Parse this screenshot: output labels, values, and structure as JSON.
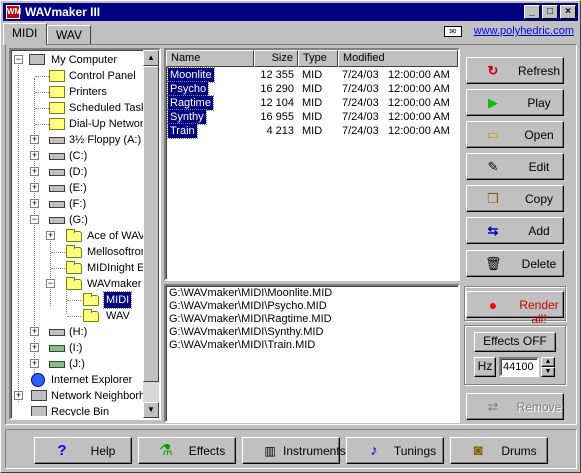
{
  "window": {
    "title": "WAVmaker III",
    "icon_text": "WM"
  },
  "titlebar_buttons": {
    "minimize": "_",
    "maximize": "□",
    "close": "×"
  },
  "tabs": [
    {
      "label": "MIDI",
      "active": true
    },
    {
      "label": "WAV",
      "active": false
    }
  ],
  "link": {
    "url_text": "www.polyhedric.com"
  },
  "tree": {
    "items": [
      {
        "label": "My Computer",
        "icon": "computer-icon"
      },
      {
        "label": "Control Panel",
        "icon": "control-panel-icon"
      },
      {
        "label": "Printers",
        "icon": "printers-icon"
      },
      {
        "label": "Scheduled Tasks",
        "icon": "scheduled-tasks-icon"
      },
      {
        "label": "Dial-Up Networking",
        "icon": "dialup-icon"
      },
      {
        "label": "3½ Floppy (A:)",
        "icon": "floppy-icon"
      },
      {
        "label": "(C:)",
        "icon": "drive-icon"
      },
      {
        "label": "(D:)",
        "icon": "drive-icon"
      },
      {
        "label": "(E:)",
        "icon": "drive-icon"
      },
      {
        "label": "(F:)",
        "icon": "drive-icon"
      },
      {
        "label": "(G:)",
        "icon": "drive-icon"
      },
      {
        "label": "Ace of WAV",
        "icon": "folder-icon"
      },
      {
        "label": "Mellosoftron",
        "icon": "folder-icon"
      },
      {
        "label": "MIDInight Express",
        "icon": "folder-icon"
      },
      {
        "label": "WAVmaker",
        "icon": "folder-open-icon"
      },
      {
        "label": "MIDI",
        "icon": "folder-open-icon"
      },
      {
        "label": "WAV",
        "icon": "folder-icon"
      },
      {
        "label": "(H:)",
        "icon": "drive-icon"
      },
      {
        "label": "(I:)",
        "icon": "network-drive-icon"
      },
      {
        "label": "(J:)",
        "icon": "network-drive-icon"
      },
      {
        "label": "Internet Explorer",
        "icon": "internet-explorer-icon"
      },
      {
        "label": "Network Neighborhood",
        "icon": "network-icon"
      },
      {
        "label": "Recycle Bin",
        "icon": "recycle-bin-icon"
      }
    ]
  },
  "filelist": {
    "columns": [
      "Name",
      "Size",
      "Type",
      "Modified"
    ],
    "rows": [
      {
        "name": "Moonlite",
        "size": "12 355",
        "type": "MID",
        "date": "7/24/03",
        "time": "12:00:00 AM"
      },
      {
        "name": "Psycho",
        "size": "16 290",
        "type": "MID",
        "date": "7/24/03",
        "time": "12:00:00 AM"
      },
      {
        "name": "Ragtime",
        "size": "12 104",
        "type": "MID",
        "date": "7/24/03",
        "time": "12:00:00 AM"
      },
      {
        "name": "Synthy",
        "size": "16 955",
        "type": "MID",
        "date": "7/24/03",
        "time": "12:00:00 AM"
      },
      {
        "name": "Train",
        "size": "4 213",
        "type": "MID",
        "date": "7/24/03",
        "time": "12:00:00 AM"
      }
    ]
  },
  "paths": [
    "G:\\WAVmaker\\MIDI\\Moonlite.MID",
    "G:\\WAVmaker\\MIDI\\Psycho.MID",
    "G:\\WAVmaker\\MIDI\\Ragtime.MID",
    "G:\\WAVmaker\\MIDI\\Synthy.MID",
    "G:\\WAVmaker\\MIDI\\Train.MID"
  ],
  "side_buttons": {
    "refresh": "Refresh",
    "play": "Play",
    "open": "Open",
    "edit": "Edit",
    "copy": "Copy",
    "add": "Add",
    "delete": "Delete"
  },
  "render": {
    "render_all": "Render all!",
    "effects_off": "Effects OFF",
    "hz_label": "Hz",
    "sample_rate": "44100",
    "remove": "Remove"
  },
  "bottom_buttons": {
    "help": "Help",
    "effects": "Effects",
    "instruments": "Instruments",
    "tunings": "Tunings",
    "drums": "Drums"
  },
  "colors": {
    "title_bar": "#000080",
    "selection": "#000080",
    "link": "#0000ff",
    "render_dot": "#ff0000",
    "play_arrow": "#00c000"
  }
}
